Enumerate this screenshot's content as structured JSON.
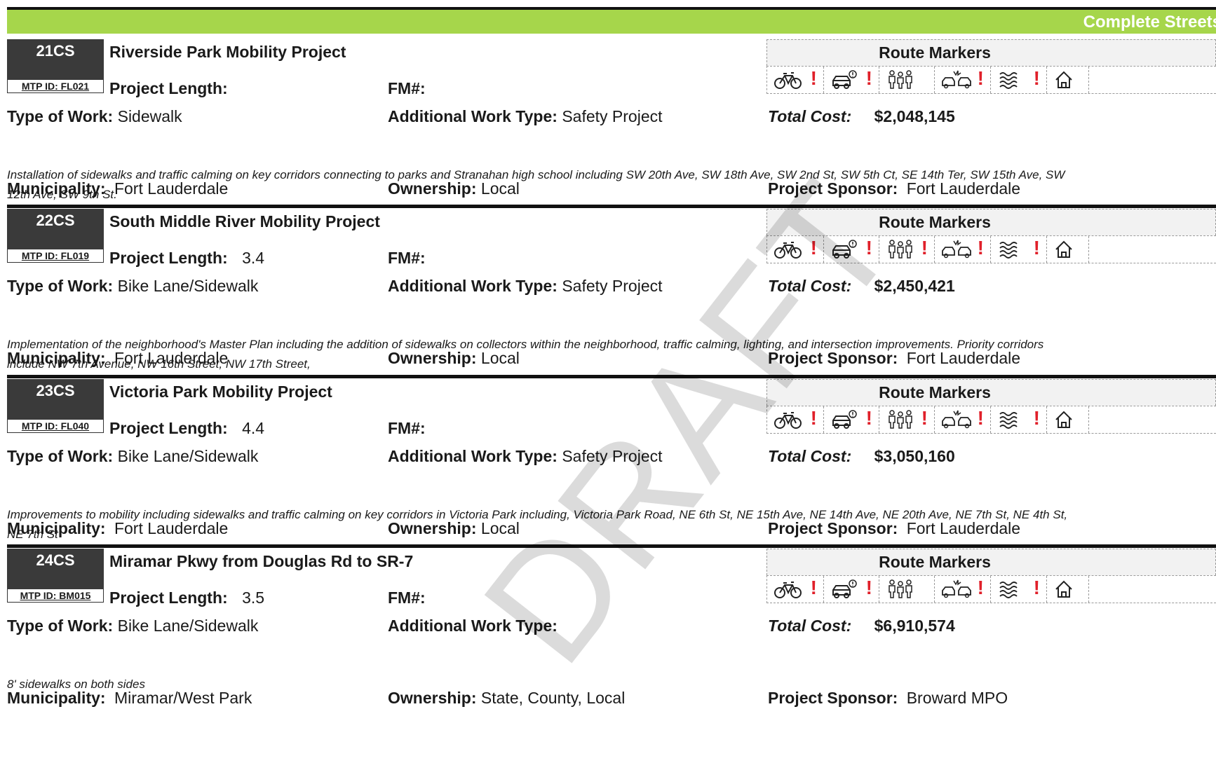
{
  "category": "Complete Streets",
  "labels": {
    "route_markers": "Route Markers",
    "project_length": "Project Length:",
    "fm": "FM#:",
    "type_of_work": "Type of Work:",
    "additional_work_type": "Additional Work Type:",
    "total_cost": "Total Cost:",
    "municipality": "Municipality:",
    "ownership": "Ownership:",
    "project_sponsor": "Project Sponsor:"
  },
  "watermark": "DRAFT",
  "projects": [
    {
      "id": "21CS",
      "mtp_id": "MTP ID: FL021",
      "title": "Riverside Park Mobility Project",
      "project_length": "",
      "fm": "",
      "type_of_work": "Sidewalk",
      "additional_work_type": "Safety Project",
      "total_cost": "$2,048,145",
      "description": "Installation of sidewalks and traffic calming on key corridors connecting to parks and Stranahan high school including SW 20th Ave, SW 18th Ave, SW 2nd St, SW 5th Ct, SE 14th Ter, SW 15th Ave, SW 12th Ave, SW 9th St.",
      "municipality": "Fort Lauderdale",
      "ownership": "Local",
      "sponsor": "Fort Lauderdale",
      "markers": [
        "!",
        "!",
        "",
        "!",
        "!",
        ""
      ]
    },
    {
      "id": "22CS",
      "mtp_id": "MTP ID: FL019",
      "title": "South Middle River Mobility Project",
      "project_length": "3.4",
      "fm": "",
      "type_of_work": "Bike Lane/Sidewalk",
      "additional_work_type": "Safety Project",
      "total_cost": "$2,450,421",
      "description": "Implementation of the neighborhood's Master Plan including the addition of sidewalks on collectors within the neighborhood, traffic calming, lighting, and intersection improvements. Priority corridors include NW 7th Avenue, NW 16th Street, NW 17th Street,",
      "municipality": "Fort Lauderdale",
      "ownership": "Local",
      "sponsor": "Fort Lauderdale",
      "markers": [
        "!",
        "!",
        "!",
        "!",
        "!",
        ""
      ]
    },
    {
      "id": "23CS",
      "mtp_id": "MTP ID: FL040",
      "title": "Victoria Park Mobility Project",
      "project_length": "4.4",
      "fm": "",
      "type_of_work": "Bike Lane/Sidewalk",
      "additional_work_type": "Safety Project",
      "total_cost": "$3,050,160",
      "description": "Improvements to mobility including sidewalks and traffic calming on key corridors in Victoria Park including, Victoria Park Road, NE 6th St, NE 15th Ave, NE 14th Ave, NE 20th Ave, NE 7th St, NE 4th St, NE 7th St",
      "municipality": "Fort Lauderdale",
      "ownership": "Local",
      "sponsor": "Fort Lauderdale",
      "markers": [
        "!",
        "!",
        "!",
        "!",
        "!",
        ""
      ]
    },
    {
      "id": "24CS",
      "mtp_id": "MTP ID: BM015",
      "title": "Miramar Pkwy from Douglas Rd to SR-7",
      "project_length": "3.5",
      "fm": "",
      "type_of_work": "Bike Lane/Sidewalk",
      "additional_work_type": "",
      "total_cost": "$6,910,574",
      "description": "8' sidewalks on both sides",
      "municipality": "Miramar/West Park",
      "ownership": "State, County, Local",
      "sponsor": "Broward MPO",
      "markers": [
        "!",
        "!",
        "",
        "!",
        "!",
        ""
      ]
    }
  ],
  "marker_icons": [
    "bicycle-icon",
    "car-alert-icon",
    "pedestrians-icon",
    "crash-icon",
    "flood-icon",
    "home-icon"
  ]
}
